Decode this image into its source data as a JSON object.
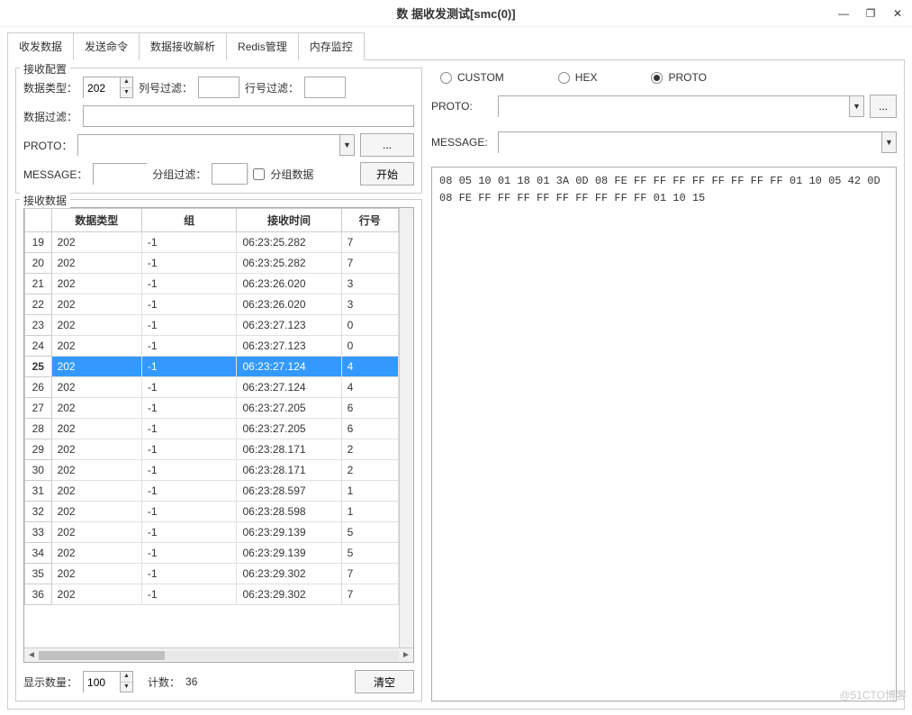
{
  "window": {
    "title": "数 据收发测试[smc(0)]",
    "controls": {
      "min": "—",
      "max": "❐",
      "close": "✕"
    }
  },
  "tabs": [
    "收发数据",
    "发送命令",
    "数据接收解析",
    "Redis管理",
    "内存监控"
  ],
  "active_tab": 2,
  "left": {
    "config_title": "接收配置",
    "labels": {
      "data_type": "数据类型：",
      "col_filter": "列号过滤：",
      "row_filter": "行号过滤：",
      "data_filter": "数据过滤：",
      "proto": "PROTO：",
      "message": "MESSAGE：",
      "group_filter": "分组过滤：",
      "group_data": "分组数据",
      "start": "开始",
      "ellipsis": "...",
      "data_type_value": "202"
    },
    "recv_title": "接收数据",
    "table": {
      "headers": [
        "数据类型",
        "组",
        "接收时间",
        "行号"
      ],
      "selected_row_num": 25,
      "rows": [
        {
          "n": 19,
          "type": "202",
          "grp": "-1",
          "time": "06:23:25.282",
          "line": "7"
        },
        {
          "n": 20,
          "type": "202",
          "grp": "-1",
          "time": "06:23:25.282",
          "line": "7"
        },
        {
          "n": 21,
          "type": "202",
          "grp": "-1",
          "time": "06:23:26.020",
          "line": "3"
        },
        {
          "n": 22,
          "type": "202",
          "grp": "-1",
          "time": "06:23:26.020",
          "line": "3"
        },
        {
          "n": 23,
          "type": "202",
          "grp": "-1",
          "time": "06:23:27.123",
          "line": "0"
        },
        {
          "n": 24,
          "type": "202",
          "grp": "-1",
          "time": "06:23:27.123",
          "line": "0"
        },
        {
          "n": 25,
          "type": "202",
          "grp": "-1",
          "time": "06:23:27.124",
          "line": "4"
        },
        {
          "n": 26,
          "type": "202",
          "grp": "-1",
          "time": "06:23:27.124",
          "line": "4"
        },
        {
          "n": 27,
          "type": "202",
          "grp": "-1",
          "time": "06:23:27.205",
          "line": "6"
        },
        {
          "n": 28,
          "type": "202",
          "grp": "-1",
          "time": "06:23:27.205",
          "line": "6"
        },
        {
          "n": 29,
          "type": "202",
          "grp": "-1",
          "time": "06:23:28.171",
          "line": "2"
        },
        {
          "n": 30,
          "type": "202",
          "grp": "-1",
          "time": "06:23:28.171",
          "line": "2"
        },
        {
          "n": 31,
          "type": "202",
          "grp": "-1",
          "time": "06:23:28.597",
          "line": "1"
        },
        {
          "n": 32,
          "type": "202",
          "grp": "-1",
          "time": "06:23:28.598",
          "line": "1"
        },
        {
          "n": 33,
          "type": "202",
          "grp": "-1",
          "time": "06:23:29.139",
          "line": "5"
        },
        {
          "n": 34,
          "type": "202",
          "grp": "-1",
          "time": "06:23:29.139",
          "line": "5"
        },
        {
          "n": 35,
          "type": "202",
          "grp": "-1",
          "time": "06:23:29.302",
          "line": "7"
        },
        {
          "n": 36,
          "type": "202",
          "grp": "-1",
          "time": "06:23:29.302",
          "line": "7"
        }
      ]
    },
    "footer": {
      "display_count_label": "显示数量：",
      "display_count_value": "100",
      "count_label": "计数：",
      "count_value": "36",
      "clear": "清空"
    }
  },
  "right": {
    "radios": {
      "custom": "CUSTOM",
      "hex": "HEX",
      "proto": "PROTO"
    },
    "selected_radio": "proto",
    "proto_label": "PROTO:",
    "message_label": "MESSAGE:",
    "ellipsis": "...",
    "hex_dump": "08 05 10 01 18 01 3A 0D 08 FE FF FF FF FF FF FF FF FF 01 10 05 42 0D 08 FE FF FF FF FF FF FF FF FF FF 01 10 15"
  },
  "watermark": "@51CTO博客"
}
